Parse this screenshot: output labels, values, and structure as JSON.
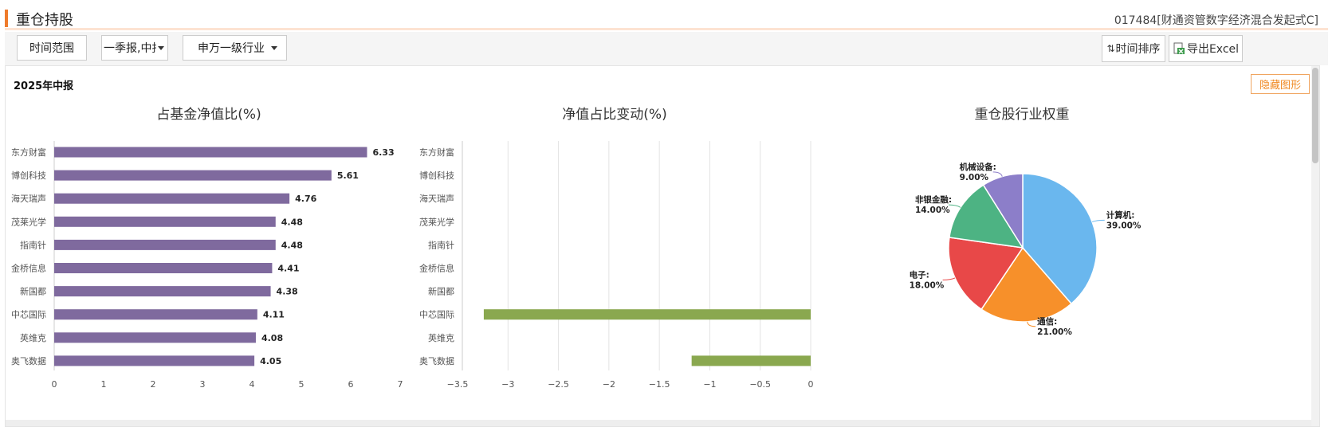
{
  "header": {
    "title": "重仓持股",
    "fund_name": "017484[财通资管数字经济混合发起式C]"
  },
  "toolbar": {
    "time_range_label": "时间范围",
    "report_select": "一季报,中报",
    "industry_select": "申万一级行业",
    "sort_button": "时间排序",
    "export_button": "导出Excel"
  },
  "panel": {
    "period_label": "2025年中报",
    "hide_chart_button": "隐藏图形"
  },
  "colors": {
    "accent": "#ef7b2b",
    "bar_purple": "#7f6a9e",
    "bar_green": "#8aa84f"
  },
  "chart_data": [
    {
      "type": "bar",
      "orientation": "horizontal",
      "title": "占基金净值比(%)",
      "categories": [
        "东方财富",
        "博创科技",
        "海天瑞声",
        "茂莱光学",
        "指南针",
        "金桥信息",
        "新国都",
        "中芯国际",
        "英维克",
        "奥飞数据"
      ],
      "values": [
        6.33,
        5.61,
        4.76,
        4.48,
        4.48,
        4.41,
        4.38,
        4.11,
        4.08,
        4.05
      ],
      "value_labels": [
        "6.33",
        "5.61",
        "4.76",
        "4.48",
        "4.48",
        "4.41",
        "4.38",
        "4.11",
        "4.08",
        "4.05"
      ],
      "xlim": [
        0,
        7
      ],
      "xticks": [
        "0",
        "1",
        "2",
        "3",
        "4",
        "5",
        "6",
        "7"
      ],
      "color": "#7f6a9e",
      "grid": false
    },
    {
      "type": "bar",
      "orientation": "horizontal",
      "title": "净值占比变动(%)",
      "categories": [
        "东方财富",
        "博创科技",
        "海天瑞声",
        "茂莱光学",
        "指南针",
        "金桥信息",
        "新国都",
        "中芯国际",
        "英维克",
        "奥飞数据"
      ],
      "values": [
        0,
        0,
        0,
        0,
        0,
        0,
        0,
        -3.24,
        0,
        -1.18
      ],
      "xlim": [
        -3.5,
        0
      ],
      "xticks": [
        "−3.5",
        "−3",
        "−2.5",
        "−2",
        "−1.5",
        "−1",
        "−0.5",
        "0"
      ],
      "color": "#8aa84f",
      "grid": true
    },
    {
      "type": "pie",
      "title": "重仓股行业权重",
      "slices": [
        {
          "label": "计算机:",
          "value": 39.0,
          "value_label": "39.00%",
          "color": "#6ab7ee"
        },
        {
          "label": "通信:",
          "value": 21.0,
          "value_label": "21.00%",
          "color": "#f7902a"
        },
        {
          "label": "电子:",
          "value": 18.0,
          "value_label": "18.00%",
          "color": "#e84848"
        },
        {
          "label": "非银金融:",
          "value": 14.0,
          "value_label": "14.00%",
          "color": "#4db383"
        },
        {
          "label": "机械设备:",
          "value": 9.0,
          "value_label": "9.00%",
          "color": "#8c7ec9"
        }
      ]
    }
  ]
}
